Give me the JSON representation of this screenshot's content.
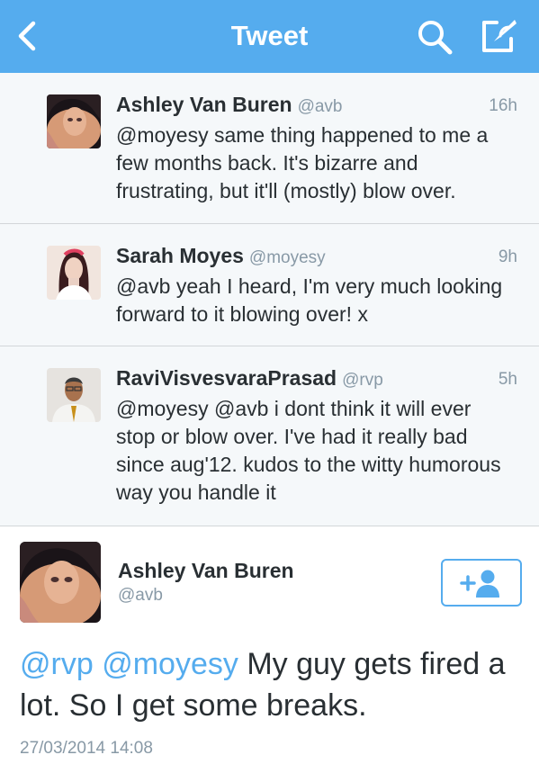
{
  "navbar": {
    "title": "Tweet",
    "back_icon": "chevron-left-icon",
    "search_icon": "search-icon",
    "compose_icon": "compose-icon",
    "color": "#55acee"
  },
  "replies": [
    {
      "name": "Ashley Van Buren",
      "handle": "@avb",
      "time": "16h",
      "text": "@moyesy same thing happened to me a few months back. It's bizarre and frustrating, but it'll (mostly) blow over."
    },
    {
      "name": "Sarah Moyes",
      "handle": "@moyesy",
      "time": "9h",
      "text": "@avb yeah I heard, I'm very much looking forward to it blowing over! x"
    },
    {
      "name": "RaviVisvesvaraPrasad",
      "handle": "@rvp",
      "time": "5h",
      "text": "@moyesy @avb i dont think it will ever stop or blow over. I've had it really bad since aug'12. kudos to the witty humorous way you handle it"
    }
  ],
  "main_tweet": {
    "name": "Ashley Van Buren",
    "handle": "@avb",
    "follow_icon": "follow-user-icon",
    "mention_1": "@rvp",
    "mention_2": "@moyesy",
    "body": "My guy gets fired a lot. So I get some breaks.",
    "date": "27/03/2014 14:08"
  },
  "colors": {
    "accent": "#55acee",
    "text": "#292f33",
    "muted": "#8899a6",
    "reply_bg": "#f5f8fa"
  }
}
